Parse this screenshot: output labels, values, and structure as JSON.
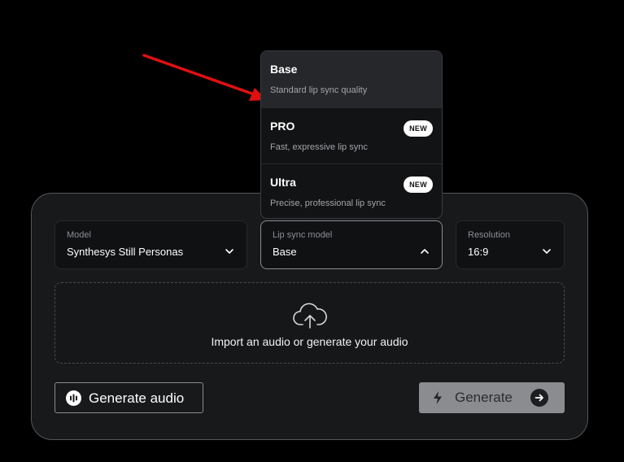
{
  "colors": {
    "panel_bg": "#18191b",
    "annotation_arrow": "#e01010",
    "generate_bg": "#8b8c8f"
  },
  "dropdown": {
    "items": [
      {
        "title": "Base",
        "desc": "Standard lip sync quality",
        "badge": "",
        "selected": true
      },
      {
        "title": "PRO",
        "desc": "Fast, expressive lip sync",
        "badge": "NEW",
        "selected": false
      },
      {
        "title": "Ultra",
        "desc": "Precise, professional lip sync",
        "badge": "NEW",
        "selected": false
      }
    ]
  },
  "selects": {
    "model": {
      "label": "Model",
      "value": "Synthesys Still Personas",
      "icon": "chevron-down-icon"
    },
    "lipsync": {
      "label": "Lip sync model",
      "value": "Base",
      "icon": "chevron-up-icon"
    },
    "resolution": {
      "label": "Resolution",
      "value": "16:9",
      "icon": "chevron-down-icon"
    }
  },
  "upload": {
    "text": "Import an audio or generate your audio",
    "icon": "cloud-upload-icon"
  },
  "buttons": {
    "generate_audio": {
      "label": "Generate audio",
      "icon": "audio-wave-icon"
    },
    "generate": {
      "label": "Generate",
      "icon": "lightning-icon",
      "trailing_icon": "arrow-right-icon"
    }
  }
}
